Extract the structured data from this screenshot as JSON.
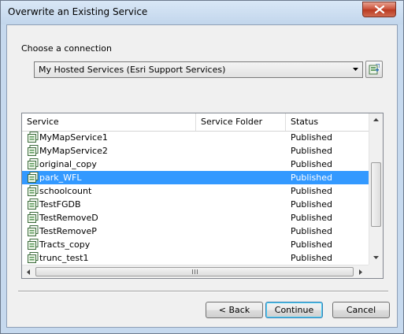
{
  "window": {
    "title": "Overwrite an Existing Service"
  },
  "connection": {
    "label": "Choose a connection",
    "selected": "My Hosted Services (Esri Support Services)",
    "add_button_icon": "add-connection-icon"
  },
  "list": {
    "columns": [
      "Service",
      "Service Folder",
      "Status"
    ],
    "rows": [
      {
        "name": "MyMapService1",
        "folder": "",
        "status": "Published",
        "selected": false
      },
      {
        "name": "MyMapService2",
        "folder": "",
        "status": "Published",
        "selected": false
      },
      {
        "name": "original_copy",
        "folder": "",
        "status": "Published",
        "selected": false
      },
      {
        "name": "park_WFL",
        "folder": "",
        "status": "Published",
        "selected": true
      },
      {
        "name": "schoolcount",
        "folder": "",
        "status": "Published",
        "selected": false
      },
      {
        "name": "TestFGDB",
        "folder": "",
        "status": "Published",
        "selected": false
      },
      {
        "name": "TestRemoveD",
        "folder": "",
        "status": "Published",
        "selected": false
      },
      {
        "name": "TestRemoveP",
        "folder": "",
        "status": "Published",
        "selected": false
      },
      {
        "name": "Tracts_copy",
        "folder": "",
        "status": "Published",
        "selected": false
      },
      {
        "name": "trunc_test1",
        "folder": "",
        "status": "Published",
        "selected": false
      }
    ]
  },
  "buttons": {
    "back": "< Back",
    "continue": "Continue",
    "cancel": "Cancel"
  },
  "colors": {
    "selection": "#3399ff",
    "title_bar": "#c6d9ee",
    "close_button": "#c94e36"
  }
}
